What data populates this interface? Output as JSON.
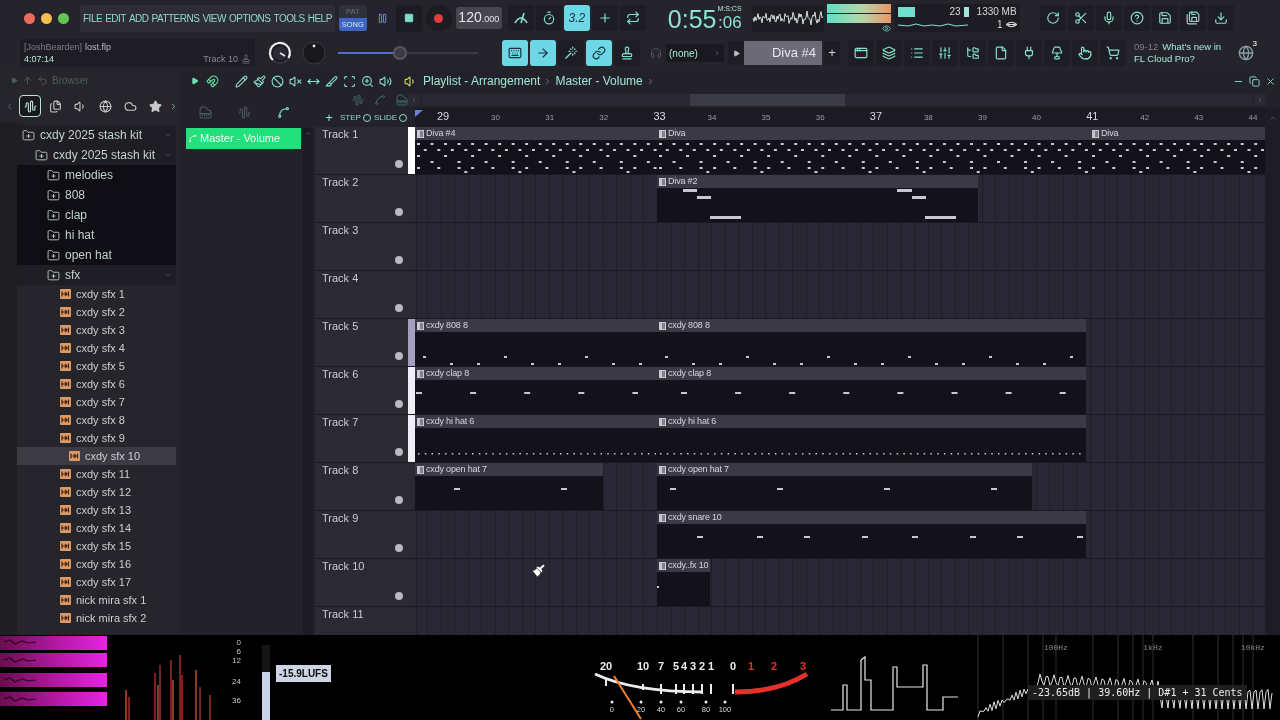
{
  "window_controls": [
    {
      "color": "#ed6a5e"
    },
    {
      "color": "#f4bf4f"
    },
    {
      "color": "#61c554"
    }
  ],
  "menu": [
    "FILE",
    "EDIT",
    "ADD",
    "PATTERNS",
    "VIEW",
    "OPTIONS",
    "TOOLS",
    "HELP"
  ],
  "transport": {
    "modes": [
      {
        "label": "PAT",
        "selected": false
      },
      {
        "label": "SONG",
        "selected": true
      }
    ],
    "playing": true,
    "tempo": "120",
    "tempo_fraction": ".000"
  },
  "record_options": [
    {
      "on": false
    },
    {
      "on": false
    },
    {
      "label": "3.2",
      "on": true
    },
    {
      "on": false
    },
    {
      "on": false
    }
  ],
  "time": {
    "main": "0:55",
    "sub": ":06",
    "unit": "M:S:CS"
  },
  "monitor": {
    "cpu": "23",
    "memory": "1330 MB",
    "voices": "1"
  },
  "project": {
    "owner": "[JoshBearden]",
    "file": "lost.flp",
    "length": "4:07:14",
    "hint": "Track 10"
  },
  "master_slider": {
    "level": 0.44
  },
  "edit_toggles": [
    {
      "on": true
    },
    {
      "on": true
    },
    {
      "on": false
    },
    {
      "on": true
    },
    {
      "on": false
    }
  ],
  "channel": "(none)",
  "pattern": "Diva #4",
  "add_pattern": "+",
  "news": {
    "date": "09-12",
    "text": "What's new in FL Cloud Pro?",
    "badge": "3"
  },
  "browser": {
    "title": "Browser",
    "tabs": [
      {
        "selected": true
      },
      {
        "selected": false
      },
      {
        "selected": false
      },
      {
        "selected": false
      },
      {
        "selected": false
      },
      {
        "selected": false
      }
    ],
    "tree": [
      {
        "label": "cxdy 2025 stash kit",
        "kind": "folder",
        "expanded": true,
        "selected": false,
        "children": [
          {
            "label": "cxdy 2025 stash kit",
            "kind": "folder",
            "expanded": true,
            "selected": false,
            "children": [
              {
                "label": "melodies",
                "kind": "folder",
                "expanded": false,
                "selected": false
              },
              {
                "label": "808",
                "kind": "folder",
                "expanded": false,
                "selected": false
              },
              {
                "label": "clap",
                "kind": "folder",
                "expanded": false,
                "selected": false
              },
              {
                "label": "hi hat",
                "kind": "folder",
                "expanded": false,
                "selected": false
              },
              {
                "label": "open hat",
                "kind": "folder",
                "expanded": false,
                "selected": false
              },
              {
                "label": "sfx",
                "kind": "folder",
                "expanded": true,
                "selected": false,
                "children": [
                  {
                    "label": "cxdy sfx 1",
                    "kind": "file",
                    "selected": false
                  },
                  {
                    "label": "cxdy sfx 2",
                    "kind": "file",
                    "selected": false
                  },
                  {
                    "label": "cxdy sfx 3",
                    "kind": "file",
                    "selected": false
                  },
                  {
                    "label": "cxdy sfx 4",
                    "kind": "file",
                    "selected": false
                  },
                  {
                    "label": "cxdy sfx 5",
                    "kind": "file",
                    "selected": false
                  },
                  {
                    "label": "cxdy sfx 6",
                    "kind": "file",
                    "selected": false
                  },
                  {
                    "label": "cxdy sfx 7",
                    "kind": "file",
                    "selected": false
                  },
                  {
                    "label": "cxdy sfx 8",
                    "kind": "file",
                    "selected": false
                  },
                  {
                    "label": "cxdy sfx 9",
                    "kind": "file",
                    "selected": false
                  },
                  {
                    "label": "cxdy sfx 10",
                    "kind": "file",
                    "selected": true
                  },
                  {
                    "label": "cxdy sfx 11",
                    "kind": "file",
                    "selected": false
                  },
                  {
                    "label": "cxdy sfx 12",
                    "kind": "file",
                    "selected": false
                  },
                  {
                    "label": "cxdy sfx 13",
                    "kind": "file",
                    "selected": false
                  },
                  {
                    "label": "cxdy sfx 14",
                    "kind": "file",
                    "selected": false
                  },
                  {
                    "label": "cxdy sfx 15",
                    "kind": "file",
                    "selected": false
                  },
                  {
                    "label": "cxdy sfx 16",
                    "kind": "file",
                    "selected": false
                  },
                  {
                    "label": "cxdy sfx 17",
                    "kind": "file",
                    "selected": false
                  },
                  {
                    "label": "nick mira sfx 1",
                    "kind": "file",
                    "selected": false
                  },
                  {
                    "label": "nick mira sfx 2",
                    "kind": "file",
                    "selected": false
                  }
                ]
              }
            ]
          }
        ]
      }
    ]
  },
  "playlist": {
    "title": "Playlist - Arrangement",
    "target": "Master - Volume",
    "clip_sources": [
      {
        "label": "Master - Volume",
        "selected": true
      }
    ],
    "add_track": "+",
    "step": "STEP",
    "slide": "SLIDE",
    "ruler": [
      {
        "label": "29",
        "major": true
      },
      {
        "label": "30",
        "major": false
      },
      {
        "label": "31",
        "major": false
      },
      {
        "label": "32",
        "major": false
      },
      {
        "label": "33",
        "major": true
      },
      {
        "label": "34",
        "major": false
      },
      {
        "label": "35",
        "major": false
      },
      {
        "label": "36",
        "major": false
      },
      {
        "label": "37",
        "major": true
      },
      {
        "label": "38",
        "major": false
      },
      {
        "label": "39",
        "major": false
      },
      {
        "label": "40",
        "major": false
      },
      {
        "label": "41",
        "major": true
      },
      {
        "label": "42",
        "major": false
      },
      {
        "label": "43",
        "major": false
      },
      {
        "label": "44",
        "major": false
      }
    ],
    "tracks": [
      {
        "name": "Track 1",
        "color": "#ffffff",
        "clips": [
          {
            "label": "Diva #4"
          },
          {
            "label": "Diva"
          },
          {
            "label": "Diva"
          }
        ]
      },
      {
        "name": "Track 2",
        "clips": [
          {
            "label": "Diva #2"
          }
        ]
      },
      {
        "name": "Track 3"
      },
      {
        "name": "Track 4"
      },
      {
        "name": "Track 5",
        "color": "#a29fc0",
        "clips": [
          {
            "label": "cxdy 808 8"
          },
          {
            "label": "cxdy 808 8"
          }
        ]
      },
      {
        "name": "Track 6",
        "color": "#f0eef8",
        "clips": [
          {
            "label": "cxdy clap 8"
          },
          {
            "label": "cxdy clap 8"
          }
        ]
      },
      {
        "name": "Track 7",
        "color": "#f0eef8",
        "clips": [
          {
            "label": "cxdy hi hat 6"
          },
          {
            "label": "cxdy hi hat 6"
          }
        ]
      },
      {
        "name": "Track 8",
        "clips": [
          {
            "label": "cxdy open hat 7"
          },
          {
            "label": "cxdy open hat 7"
          }
        ]
      },
      {
        "name": "Track 9",
        "clips": [
          {
            "label": "cxdy snare 10"
          }
        ]
      },
      {
        "name": "Track 10",
        "clips": [
          {
            "label": "cxdy..fx 10"
          }
        ]
      },
      {
        "name": "Track 11"
      }
    ]
  },
  "meters": {
    "lufs_scale": [
      "0",
      "6",
      "12",
      "24",
      "36"
    ],
    "lufs": {
      "reading": "-15.9LUFS",
      "level": 0.64
    },
    "vu": {
      "scale": [
        {
          "label": "20",
          "color": "#ececec"
        },
        {
          "label": "10",
          "color": "#ececec"
        },
        {
          "label": "7",
          "color": "#ececec"
        },
        {
          "label": "5",
          "color": "#ececec"
        },
        {
          "label": "4",
          "color": "#ececec"
        },
        {
          "label": "3",
          "color": "#ececec"
        },
        {
          "label": "2",
          "color": "#ececec"
        },
        {
          "label": "1",
          "color": "#ececec"
        },
        {
          "label": "0",
          "color": "#ececec"
        },
        {
          "label": "1",
          "color": "#e8302a"
        },
        {
          "label": "2",
          "color": "#e8302a"
        },
        {
          "label": "3",
          "color": "#e8302a"
        }
      ],
      "percent": [
        "0",
        "20",
        "40",
        "60",
        "80",
        "100"
      ]
    },
    "spectrum": {
      "bands": [
        "100Hz",
        "1kHz",
        "10kHz"
      ],
      "readout": "-23.65dB | 39.60Hz | D#1 + 31 Cents"
    }
  }
}
